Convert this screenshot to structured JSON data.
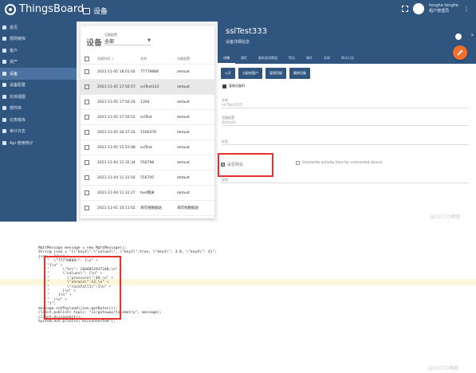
{
  "topbar": {
    "brand": "ThingsBoard",
    "breadcrumb": "设备",
    "user_name": "tenghe tenghe",
    "user_role": "租户管理员"
  },
  "sidebar": {
    "items": [
      {
        "label": "首页"
      },
      {
        "label": "规则链库"
      },
      {
        "label": "客户"
      },
      {
        "label": "资产"
      },
      {
        "label": "设备",
        "active": true
      },
      {
        "label": "设备配置"
      },
      {
        "label": "实体视图"
      },
      {
        "label": "部件库"
      },
      {
        "label": "仪表板库"
      },
      {
        "label": "审计日志"
      },
      {
        "label": "Api 使用统计"
      }
    ]
  },
  "device_list": {
    "title": "设备",
    "filter_label": "设备配置",
    "filter_value": "全部",
    "columns": [
      "创建时间 ↓",
      "名称",
      "设备配置"
    ],
    "rows": [
      {
        "created": "2021-11-05 18:01:02",
        "name": "77778888",
        "profile": "default",
        "selected": false
      },
      {
        "created": "2021-11-05 17:56:57",
        "name": "sslTest333",
        "profile": "default",
        "selected": true
      },
      {
        "created": "2021-11-05 17:56:24",
        "name": "1304",
        "profile": "default",
        "selected": false
      },
      {
        "created": "2021-11-05 17:50:52",
        "name": "sslTest",
        "profile": "default",
        "selected": false
      },
      {
        "created": "2021-11-05 16:37:24",
        "name": "1500376",
        "profile": "default",
        "selected": false
      },
      {
        "created": "2021-11-05 15:55:08",
        "name": "sslTest",
        "profile": "default",
        "selected": false
      },
      {
        "created": "2021-11-04 11:35:34",
        "name": "556798",
        "profile": "default",
        "selected": false
      },
      {
        "created": "2021-11-04 11:31:56",
        "name": "556795",
        "profile": "default",
        "selected": false
      },
      {
        "created": "2021-11-04 11:31:27",
        "name": "test网关",
        "profile": "default",
        "selected": false
      },
      {
        "created": "2021-11-01 10:11:02",
        "name": "海可视数据站",
        "profile": "海可视数据站",
        "selected": false
      }
    ]
  },
  "device_detail": {
    "title": "sslTest333",
    "subtitle": "设备详细信息",
    "tabs": [
      "详情",
      "属性",
      "最新遥测数据",
      "警告",
      "事件",
      "关联",
      "审计日志"
    ],
    "actions": [
      "公开",
      "分配给客户",
      "管理凭据",
      "删除设备"
    ],
    "copy_id_label": "复制设备ID",
    "fields": [
      {
        "label": "名称",
        "value": "sslTest333"
      },
      {
        "label": "设备配置",
        "value": "default"
      },
      {
        "label": "标签",
        "value": ""
      },
      {
        "label": "说明",
        "value": ""
      }
    ],
    "gateway_label": "是否网关",
    "overwrite_label": "Overwrite activity time for connected device",
    "watermark": "@51CTO博客"
  },
  "code": {
    "lines": [
      "MqttMessage message = new MqttMessage();",
      "String json = \"{\\\"key1\\\":\\\"value1\\\", \\\"key2\\\":true, \\\"key3\\\": 3.0, \\\"key4\\\": 4}\";",
      "json = \"{\\n\" +",
      "    \"  \\\"77778888\\\": [\\n\" +",
      "    \"{\\n\" +",
      "    \"      \\\"ts\\\": 1604852937240,\\n\" +",
      "    \"      \\\"values\\\": {\\n\" +",
      "    \"        \\\"pressure\\\":49,\\n\" +",
      "    \"        \\\"shrain\\\":13,\\n\" +",
      "    \"        \\\"rainfall1\\\":1\\n\" +",
      "    \"      }\\n\" +",
      "    \"    }\\n\" +",
      "    \"  ]\\n\" +",
      "    \"}\";",
      "message.setPayload(json.getBytes());",
      "client.publish( topic: \"v1/gateway/telemetry\", message);",
      "client.disconnect();",
      "System.out.println(\"Disconnected\");"
    ],
    "watermark": "@51CTO博客"
  }
}
